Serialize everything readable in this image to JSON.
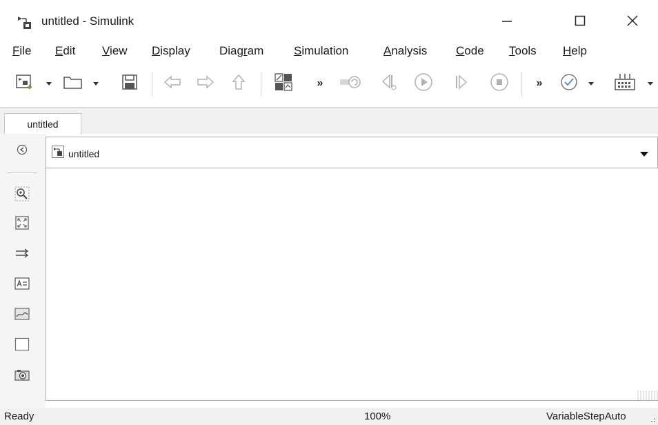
{
  "window": {
    "title": "untitled - Simulink"
  },
  "menu": {
    "items": [
      {
        "mnemonic": "F",
        "rest": "ile"
      },
      {
        "mnemonic": "E",
        "rest": "dit"
      },
      {
        "mnemonic": "V",
        "rest": "iew"
      },
      {
        "mnemonic": "D",
        "rest": "isplay"
      },
      {
        "prefix": "Diag",
        "mnemonic": "r",
        "rest": "am"
      },
      {
        "mnemonic": "S",
        "rest": "imulation"
      },
      {
        "mnemonic": "A",
        "rest": "nalysis"
      },
      {
        "mnemonic": "C",
        "rest": "ode"
      },
      {
        "mnemonic": "T",
        "rest": "ools"
      },
      {
        "mnemonic": "H",
        "rest": "elp"
      }
    ]
  },
  "toolbar": {
    "more_label": "»"
  },
  "tabs": {
    "active": "untitled"
  },
  "address": {
    "path": "untitled"
  },
  "status": {
    "left": "Ready",
    "zoom": "100%",
    "solver": "VariableStepAuto"
  },
  "colors": {
    "icon_gray": "#b0b0b0",
    "icon_dark": "#555555",
    "check_blue": "#5a8fc9",
    "accent_green": "#6a9e3a"
  },
  "icons": {
    "app": "simulink-model-icon",
    "minimize": "minimize-icon",
    "maximize": "maximize-icon",
    "close": "close-icon"
  }
}
